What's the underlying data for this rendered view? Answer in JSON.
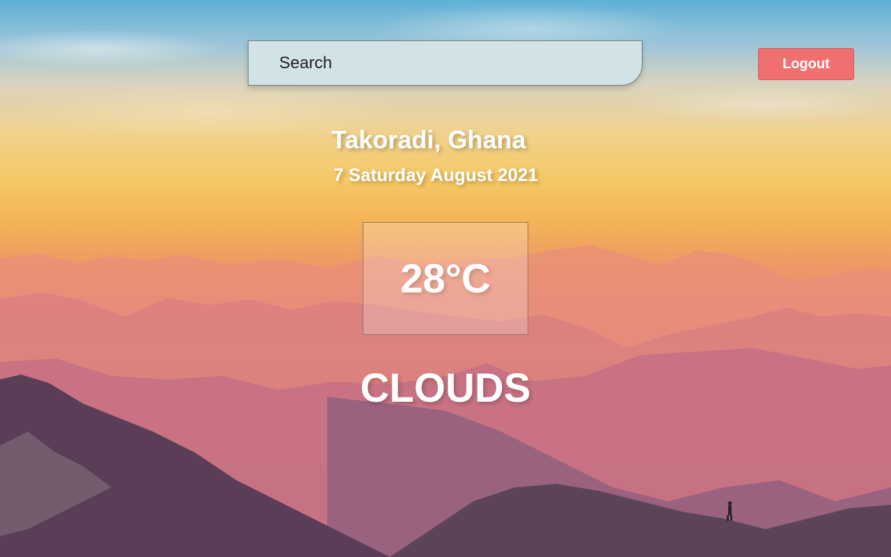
{
  "search": {
    "placeholder": "Search"
  },
  "header": {
    "logout_label": "Logout"
  },
  "weather": {
    "location": "Takoradi, Ghana",
    "date": "7 Saturday August 2021",
    "temperature": "28°C",
    "condition": "CLOUDS"
  },
  "colors": {
    "logout_button": "#f07070",
    "search_background": "#d1e3e6",
    "text": "#ffffff"
  }
}
